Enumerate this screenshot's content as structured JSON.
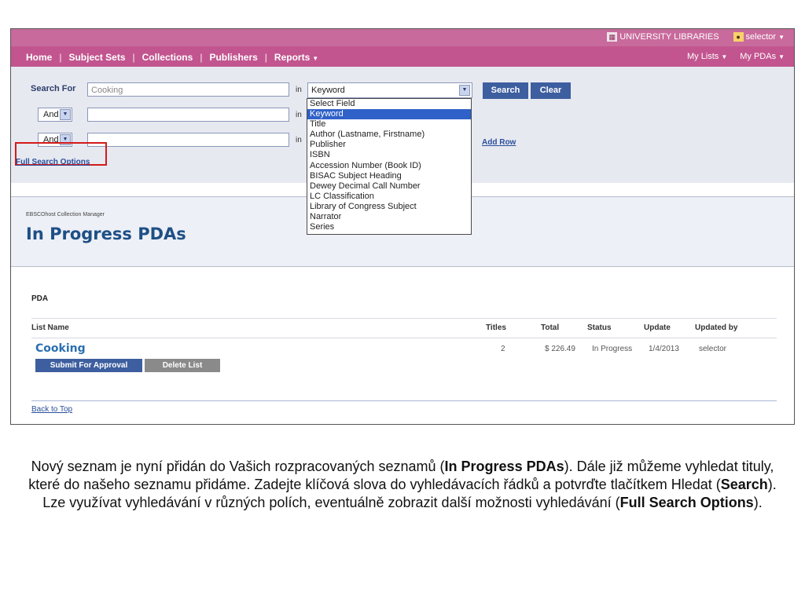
{
  "topbar": {
    "institution": "UNIVERSITY LIBRARIES",
    "user": "selector"
  },
  "nav": {
    "items": [
      "Home",
      "Subject Sets",
      "Collections",
      "Publishers",
      "Reports"
    ],
    "right": [
      "My Lists",
      "My PDAs"
    ]
  },
  "search": {
    "label": "Search For",
    "query": "Cooking",
    "in_label": "in",
    "bool1": "And",
    "bool2": "And",
    "field_selected": "Keyword",
    "search_button": "Search",
    "clear_button": "Clear",
    "add_row": "Add Row",
    "full_options": "Full Search Options",
    "field_options": [
      "Select Field",
      "Keyword",
      "Title",
      "Author (Lastname, Firstname)",
      "Publisher",
      "ISBN",
      "Accession Number (Book ID)",
      "BISAC Subject Heading",
      "Dewey Decimal Call Number",
      "LC Classification",
      "Library of Congress Subject",
      "Narrator",
      "Series"
    ]
  },
  "heading": {
    "small": "EBSCOhost Collection Manager",
    "title": "In Progress PDAs"
  },
  "pda": {
    "label": "PDA",
    "columns": [
      "List Name",
      "Titles",
      "Total",
      "Status",
      "Update",
      "Updated by"
    ],
    "row": {
      "name": "Cooking",
      "titles": "2",
      "total": "$ 226.49",
      "status": "In Progress",
      "update": "1/4/2013",
      "updated_by": "selector"
    },
    "submit_button": "Submit For Approval",
    "delete_button": "Delete List",
    "back_to_top": "Back to Top"
  },
  "caption": {
    "p1": "Nový seznam je nyní přidán  do Vašich rozpracovaných seznamů (",
    "b1": "In Progress PDAs",
    "p2": "). Dále již můžeme vyhledat tituly, které do našeho seznamu přidáme. Zadejte klíčová slova do vyhledávacích řádků a potvrďte tlačítkem Hledat (",
    "b2": "Search",
    "p3": "). Lze využívat vyhledávání v různých polích, eventuálně zobrazit další možnosti vyhledávání (",
    "b3": "Full Search Options",
    "p4": ")."
  }
}
